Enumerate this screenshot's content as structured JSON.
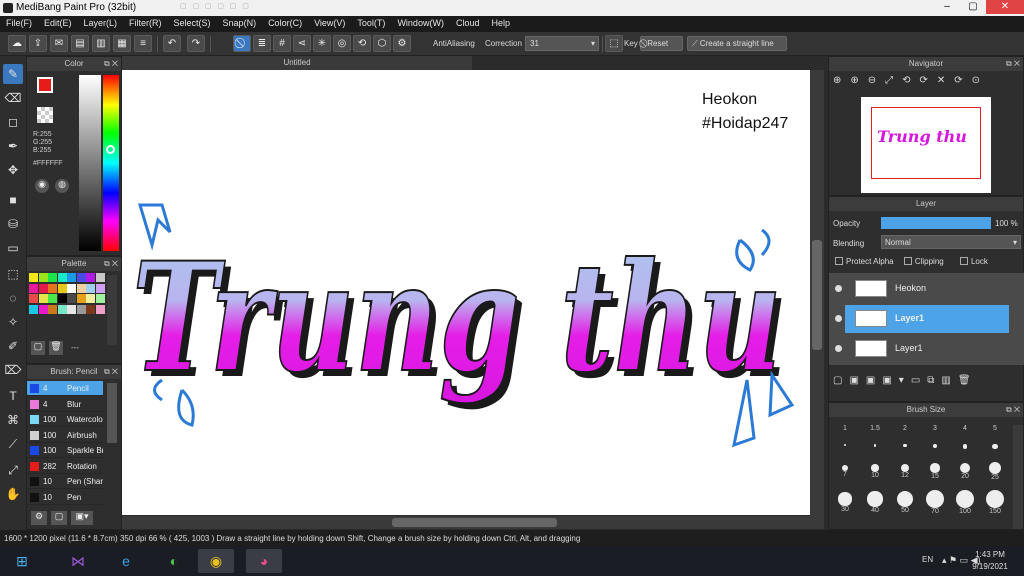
{
  "window": {
    "title": "MediBang Paint Pro (32bit)",
    "controls": [
      "–",
      "▢",
      "✕"
    ]
  },
  "menu": [
    "File(F)",
    "Edit(E)",
    "Layer(L)",
    "Filter(R)",
    "Select(S)",
    "Snap(N)",
    "Color(C)",
    "View(V)",
    "Tool(T)",
    "Window(W)",
    "Cloud",
    "Help"
  ],
  "toolbar": {
    "antialiasing_label": "AntiAliasing",
    "correction_label": "Correction",
    "correction_value": "31",
    "key_label": "Key",
    "reset_label": "Reset",
    "straight_line_label": "Create a straight line"
  },
  "color_panel": {
    "title": "Color",
    "r": "R:255",
    "g": "G:255",
    "b": "B:255",
    "hex": "#FFFFFF",
    "fg": "#e81b1b",
    "bg": "#f58a1f"
  },
  "palette_panel": {
    "title": "Palette",
    "dash": "---",
    "swatches": [
      "#f5e61a",
      "#9ae61a",
      "#1ae64a",
      "#1ae6c8",
      "#1a9ae6",
      "#4a4ae6",
      "#b01ae6",
      "#c8c8c8",
      "#e61a9a",
      "#e61a4a",
      "#e6741a",
      "#e6c81a",
      "#ffffff",
      "#f0d0a0",
      "#a0d0f0",
      "#d0a0f0",
      "#e64a4a",
      "#e6e64a",
      "#4ae64a",
      "#000000",
      "#4a4a4a",
      "#e6a01a",
      "#f0f0a0",
      "#a0f0a0",
      "#1ac8e6",
      "#e61ac8",
      "#c87a1a",
      "#7ae6c8",
      "#e6e6e6",
      "#9a9a9a",
      "#7a3a1a",
      "#f0a0c8"
    ]
  },
  "brush_panel": {
    "title": "Brush: Pencil",
    "items": [
      {
        "size": "4",
        "name": "Pencil",
        "color": "#1a4ae6",
        "selected": true
      },
      {
        "size": "4",
        "name": "Blur",
        "color": "#e87ad8",
        "selected": false
      },
      {
        "size": "100",
        "name": "Watercolor",
        "color": "#7ad8f0",
        "selected": false
      },
      {
        "size": "100",
        "name": "Airbrush",
        "color": "#d0d0d0",
        "selected": false
      },
      {
        "size": "100",
        "name": "Sparkle Brush",
        "color": "#1a4ae6",
        "selected": false
      },
      {
        "size": "282",
        "name": "Rotation",
        "color": "#e81b1b",
        "selected": false
      },
      {
        "size": "10",
        "name": "Pen (Sharp)",
        "color": "#111111",
        "selected": false
      },
      {
        "size": "10",
        "name": "Pen",
        "color": "#111111",
        "selected": false
      }
    ]
  },
  "document": {
    "tab_title": "Untitled",
    "text_line1": "Heokon",
    "text_line2": "#Hoidap247",
    "artwork_text": "Trung thu"
  },
  "navigator": {
    "title": "Navigator"
  },
  "layer_panel": {
    "title": "Layer",
    "opacity_label": "Opacity",
    "opacity_value": "100 %",
    "opacity_fraction": 1.0,
    "blending_label": "Blending",
    "blending_value": "Normal",
    "protect_alpha": "Protect Alpha",
    "clipping": "Clipping",
    "lock": "Lock",
    "layers": [
      {
        "name": "Heokon",
        "selected": false
      },
      {
        "name": "Layer1",
        "selected": true
      },
      {
        "name": "Layer1",
        "selected": false
      }
    ]
  },
  "brush_size_panel": {
    "title": "Brush Size",
    "sizes": [
      "1",
      "1.5",
      "2",
      "3",
      "4",
      "5",
      "7",
      "10",
      "12",
      "15",
      "20",
      "25",
      "30",
      "40",
      "50",
      "70",
      "100",
      "150"
    ]
  },
  "status": {
    "dimensions": "1600 * 1200 pixel",
    "physical": "(11.6 * 8.7cm)",
    "dpi": "350 dpi",
    "zoom": "66 %",
    "coords": "( 425, 1003 )",
    "hint": "Draw a straight line by holding down Shift, Change a brush size by holding down Ctrl, Alt, and dragging"
  },
  "taskbar": {
    "lang": "EN",
    "time": "1:43 PM",
    "date": "9/19/2021"
  }
}
